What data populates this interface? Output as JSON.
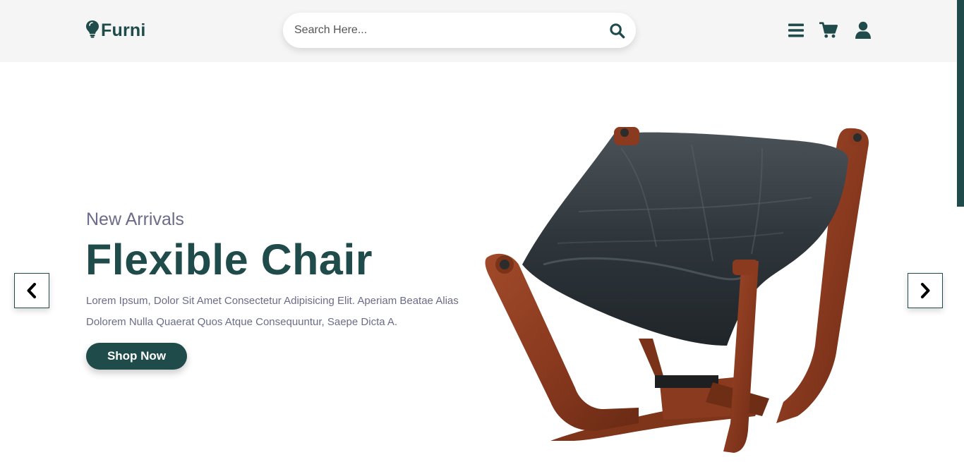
{
  "header": {
    "logo_text": "Furni",
    "search_placeholder": "Search Here...",
    "icons": [
      "menu-icon",
      "cart-icon",
      "user-icon"
    ]
  },
  "hero": {
    "subtitle": "New Arrivals",
    "title": "Flexible Chair",
    "description": "Lorem Ipsum, Dolor Sit Amet Consectetur Adipisicing Elit. Aperiam Beatae Alias Dolorem Nulla Quaerat Quos Atque Consequuntur, Saepe Dicta A.",
    "cta_label": "Shop Now"
  },
  "colors": {
    "brand": "#204b4b",
    "text_muted": "#6a6c8a",
    "header_bg": "#f5f5f5"
  }
}
